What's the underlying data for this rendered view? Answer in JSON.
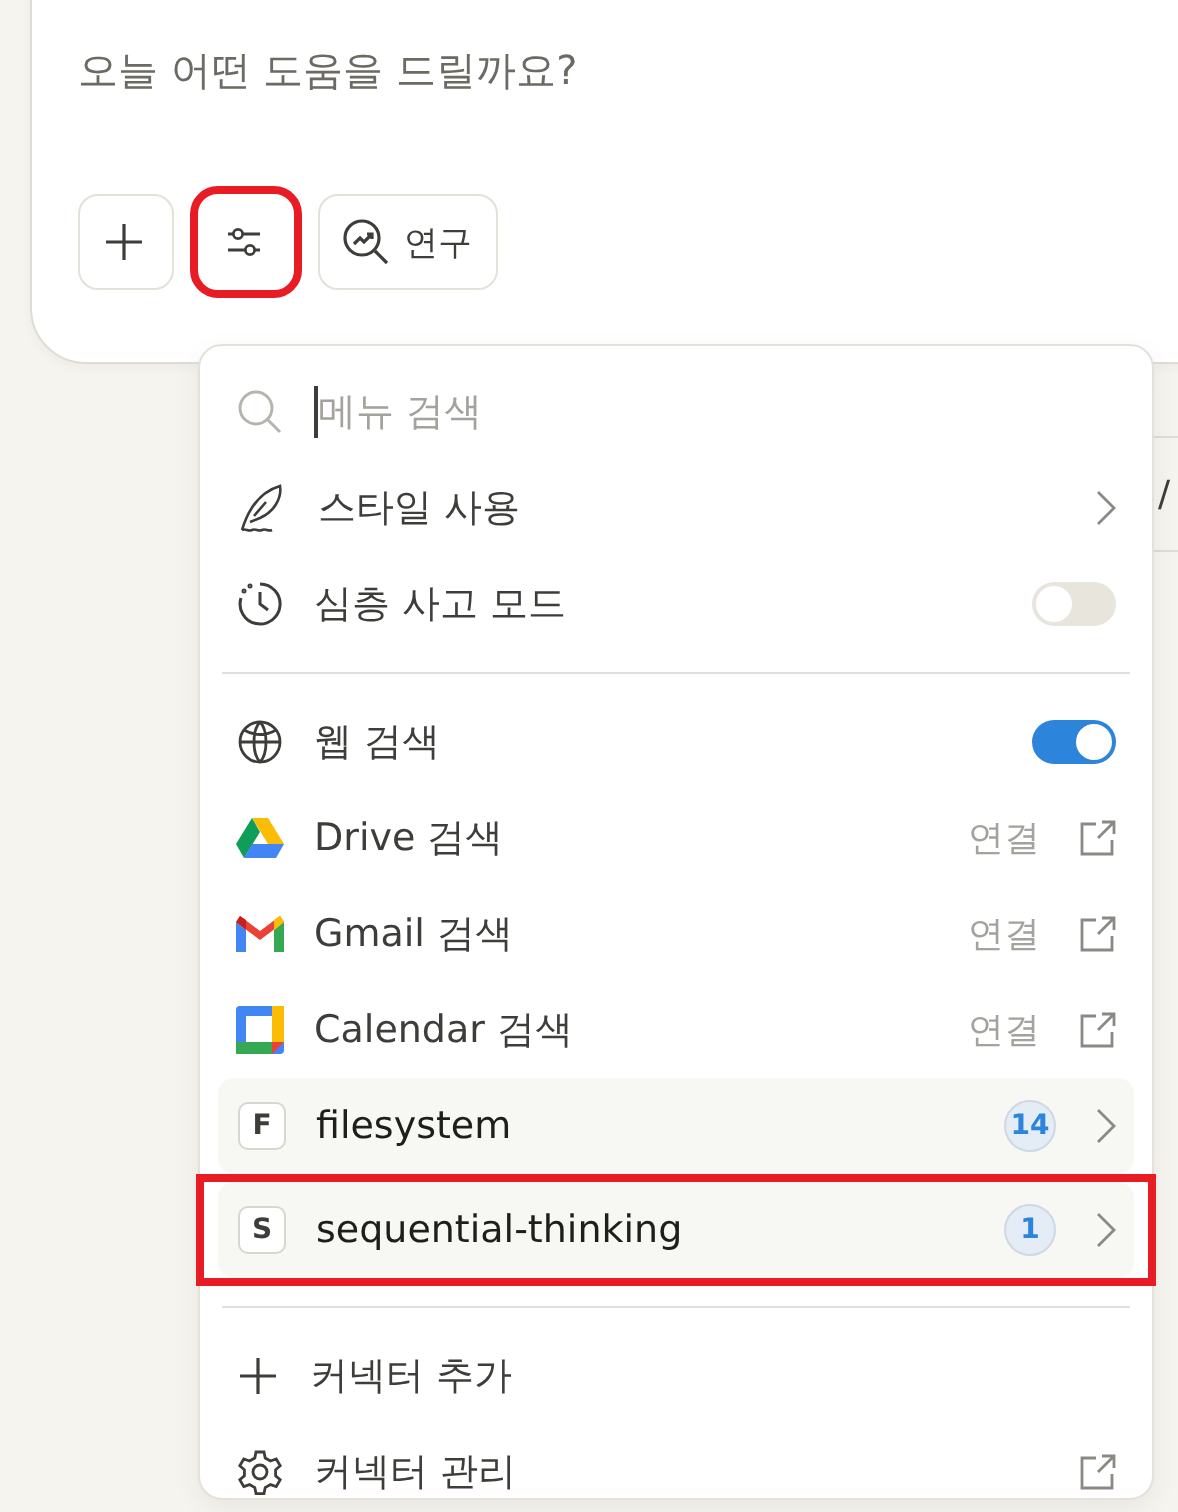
{
  "composer": {
    "placeholder": "오늘 어떤 도움을 드릴까요?"
  },
  "toolbar": [
    {
      "kind": "add",
      "highlighted": false
    },
    {
      "kind": "tools",
      "highlighted": true
    },
    {
      "kind": "research",
      "label": "연구",
      "highlighted": false
    }
  ],
  "background_fragment": "/",
  "menu": {
    "search": {
      "placeholder": "메뉴 검색"
    },
    "sections": [
      [
        {
          "kind": "submenu",
          "label": "스타일 사용"
        },
        {
          "kind": "toggle",
          "label": "심층 사고 모드",
          "on": false
        }
      ],
      [
        {
          "kind": "toggle",
          "label": "웹 검색",
          "on": true
        },
        {
          "kind": "connect",
          "label": "Drive 검색",
          "action": "연결"
        },
        {
          "kind": "connect",
          "label": "Gmail 검색",
          "action": "연결"
        },
        {
          "kind": "connect",
          "label": "Calendar 검색",
          "action": "연결"
        },
        {
          "kind": "connector",
          "initial": "F",
          "label": "filesystem",
          "count": "14",
          "highlighted": false
        },
        {
          "kind": "connector",
          "initial": "S",
          "label": "sequential-thinking",
          "count": "1",
          "highlighted": true
        }
      ],
      [
        {
          "kind": "action",
          "label": "커넥터 추가"
        },
        {
          "kind": "external",
          "label": "커넥터 관리"
        }
      ]
    ]
  }
}
